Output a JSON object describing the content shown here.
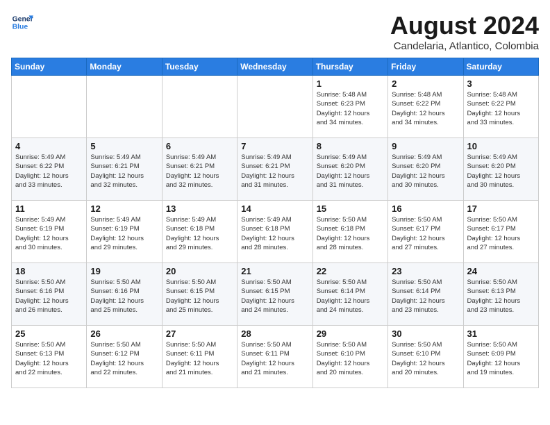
{
  "header": {
    "logo_line1": "General",
    "logo_line2": "Blue",
    "title": "August 2024",
    "subtitle": "Candelaria, Atlantico, Colombia"
  },
  "weekdays": [
    "Sunday",
    "Monday",
    "Tuesday",
    "Wednesday",
    "Thursday",
    "Friday",
    "Saturday"
  ],
  "weeks": [
    [
      {
        "day": "",
        "info": ""
      },
      {
        "day": "",
        "info": ""
      },
      {
        "day": "",
        "info": ""
      },
      {
        "day": "",
        "info": ""
      },
      {
        "day": "1",
        "info": "Sunrise: 5:48 AM\nSunset: 6:23 PM\nDaylight: 12 hours\nand 34 minutes."
      },
      {
        "day": "2",
        "info": "Sunrise: 5:48 AM\nSunset: 6:22 PM\nDaylight: 12 hours\nand 34 minutes."
      },
      {
        "day": "3",
        "info": "Sunrise: 5:48 AM\nSunset: 6:22 PM\nDaylight: 12 hours\nand 33 minutes."
      }
    ],
    [
      {
        "day": "4",
        "info": "Sunrise: 5:49 AM\nSunset: 6:22 PM\nDaylight: 12 hours\nand 33 minutes."
      },
      {
        "day": "5",
        "info": "Sunrise: 5:49 AM\nSunset: 6:21 PM\nDaylight: 12 hours\nand 32 minutes."
      },
      {
        "day": "6",
        "info": "Sunrise: 5:49 AM\nSunset: 6:21 PM\nDaylight: 12 hours\nand 32 minutes."
      },
      {
        "day": "7",
        "info": "Sunrise: 5:49 AM\nSunset: 6:21 PM\nDaylight: 12 hours\nand 31 minutes."
      },
      {
        "day": "8",
        "info": "Sunrise: 5:49 AM\nSunset: 6:20 PM\nDaylight: 12 hours\nand 31 minutes."
      },
      {
        "day": "9",
        "info": "Sunrise: 5:49 AM\nSunset: 6:20 PM\nDaylight: 12 hours\nand 30 minutes."
      },
      {
        "day": "10",
        "info": "Sunrise: 5:49 AM\nSunset: 6:20 PM\nDaylight: 12 hours\nand 30 minutes."
      }
    ],
    [
      {
        "day": "11",
        "info": "Sunrise: 5:49 AM\nSunset: 6:19 PM\nDaylight: 12 hours\nand 30 minutes."
      },
      {
        "day": "12",
        "info": "Sunrise: 5:49 AM\nSunset: 6:19 PM\nDaylight: 12 hours\nand 29 minutes."
      },
      {
        "day": "13",
        "info": "Sunrise: 5:49 AM\nSunset: 6:18 PM\nDaylight: 12 hours\nand 29 minutes."
      },
      {
        "day": "14",
        "info": "Sunrise: 5:49 AM\nSunset: 6:18 PM\nDaylight: 12 hours\nand 28 minutes."
      },
      {
        "day": "15",
        "info": "Sunrise: 5:50 AM\nSunset: 6:18 PM\nDaylight: 12 hours\nand 28 minutes."
      },
      {
        "day": "16",
        "info": "Sunrise: 5:50 AM\nSunset: 6:17 PM\nDaylight: 12 hours\nand 27 minutes."
      },
      {
        "day": "17",
        "info": "Sunrise: 5:50 AM\nSunset: 6:17 PM\nDaylight: 12 hours\nand 27 minutes."
      }
    ],
    [
      {
        "day": "18",
        "info": "Sunrise: 5:50 AM\nSunset: 6:16 PM\nDaylight: 12 hours\nand 26 minutes."
      },
      {
        "day": "19",
        "info": "Sunrise: 5:50 AM\nSunset: 6:16 PM\nDaylight: 12 hours\nand 25 minutes."
      },
      {
        "day": "20",
        "info": "Sunrise: 5:50 AM\nSunset: 6:15 PM\nDaylight: 12 hours\nand 25 minutes."
      },
      {
        "day": "21",
        "info": "Sunrise: 5:50 AM\nSunset: 6:15 PM\nDaylight: 12 hours\nand 24 minutes."
      },
      {
        "day": "22",
        "info": "Sunrise: 5:50 AM\nSunset: 6:14 PM\nDaylight: 12 hours\nand 24 minutes."
      },
      {
        "day": "23",
        "info": "Sunrise: 5:50 AM\nSunset: 6:14 PM\nDaylight: 12 hours\nand 23 minutes."
      },
      {
        "day": "24",
        "info": "Sunrise: 5:50 AM\nSunset: 6:13 PM\nDaylight: 12 hours\nand 23 minutes."
      }
    ],
    [
      {
        "day": "25",
        "info": "Sunrise: 5:50 AM\nSunset: 6:13 PM\nDaylight: 12 hours\nand 22 minutes."
      },
      {
        "day": "26",
        "info": "Sunrise: 5:50 AM\nSunset: 6:12 PM\nDaylight: 12 hours\nand 22 minutes."
      },
      {
        "day": "27",
        "info": "Sunrise: 5:50 AM\nSunset: 6:11 PM\nDaylight: 12 hours\nand 21 minutes."
      },
      {
        "day": "28",
        "info": "Sunrise: 5:50 AM\nSunset: 6:11 PM\nDaylight: 12 hours\nand 21 minutes."
      },
      {
        "day": "29",
        "info": "Sunrise: 5:50 AM\nSunset: 6:10 PM\nDaylight: 12 hours\nand 20 minutes."
      },
      {
        "day": "30",
        "info": "Sunrise: 5:50 AM\nSunset: 6:10 PM\nDaylight: 12 hours\nand 20 minutes."
      },
      {
        "day": "31",
        "info": "Sunrise: 5:50 AM\nSunset: 6:09 PM\nDaylight: 12 hours\nand 19 minutes."
      }
    ]
  ]
}
